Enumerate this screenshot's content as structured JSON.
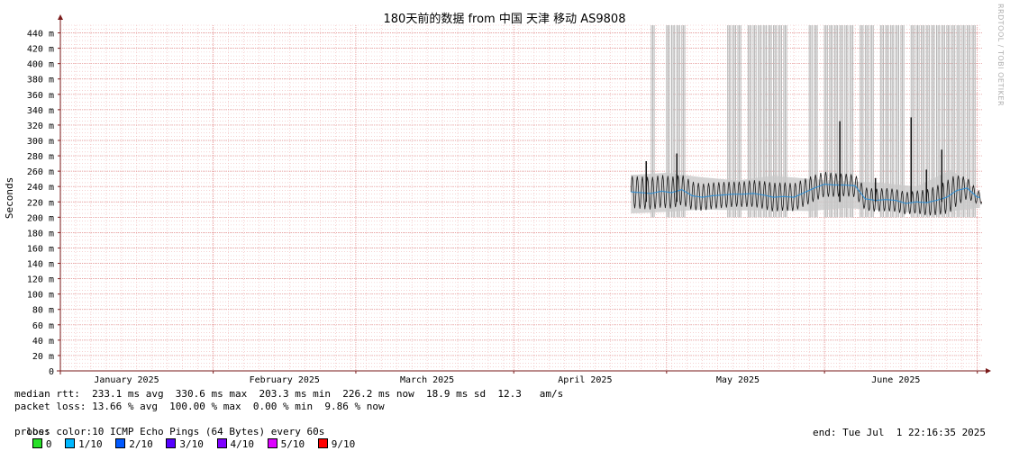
{
  "chart_data": {
    "type": "line",
    "title": "180天前的数据 from 中国 天津 移动 AS9808",
    "ylabel": "Seconds",
    "ylim": [
      0,
      0.45
    ],
    "yticks": [
      {
        "v": 0,
        "label": "0"
      },
      {
        "v": 0.02,
        "label": "20 m"
      },
      {
        "v": 0.04,
        "label": "40 m"
      },
      {
        "v": 0.06,
        "label": "60 m"
      },
      {
        "v": 0.08,
        "label": "80 m"
      },
      {
        "v": 0.1,
        "label": "100 m"
      },
      {
        "v": 0.12,
        "label": "120 m"
      },
      {
        "v": 0.14,
        "label": "140 m"
      },
      {
        "v": 0.16,
        "label": "160 m"
      },
      {
        "v": 0.18,
        "label": "180 m"
      },
      {
        "v": 0.2,
        "label": "200 m"
      },
      {
        "v": 0.22,
        "label": "220 m"
      },
      {
        "v": 0.24,
        "label": "240 m"
      },
      {
        "v": 0.26,
        "label": "260 m"
      },
      {
        "v": 0.28,
        "label": "280 m"
      },
      {
        "v": 0.3,
        "label": "300 m"
      },
      {
        "v": 0.32,
        "label": "320 m"
      },
      {
        "v": 0.34,
        "label": "340 m"
      },
      {
        "v": 0.36,
        "label": "360 m"
      },
      {
        "v": 0.38,
        "label": "380 m"
      },
      {
        "v": 0.4,
        "label": "400 m"
      },
      {
        "v": 0.42,
        "label": "420 m"
      },
      {
        "v": 0.44,
        "label": "440 m"
      }
    ],
    "xlim": [
      "2025-01-02",
      "2025-07-01"
    ],
    "xticks": [
      {
        "date": "2025-01-15",
        "label": "January 2025"
      },
      {
        "date": "2025-02-15",
        "label": "February 2025"
      },
      {
        "date": "2025-03-15",
        "label": "March 2025"
      },
      {
        "date": "2025-04-15",
        "label": "April 2025"
      },
      {
        "date": "2025-05-15",
        "label": "May 2025"
      },
      {
        "date": "2025-06-15",
        "label": "June 2025"
      }
    ],
    "month_starts": [
      "2025-01-01",
      "2025-02-01",
      "2025-03-01",
      "2025-04-01",
      "2025-05-01",
      "2025-06-01",
      "2025-07-01"
    ],
    "data_start": "2025-04-24",
    "data_end": "2025-07-01",
    "series": [
      {
        "x": [
          "2025-04-24",
          "2025-04-26",
          "2025-04-28",
          "2025-04-30",
          "2025-05-02",
          "2025-05-04",
          "2025-05-06",
          "2025-05-08",
          "2025-05-10",
          "2025-05-12",
          "2025-05-14",
          "2025-05-16",
          "2025-05-18",
          "2025-05-20",
          "2025-05-22",
          "2025-05-24",
          "2025-05-26",
          "2025-05-28",
          "2025-05-30",
          "2025-06-01",
          "2025-06-03",
          "2025-06-05",
          "2025-06-07",
          "2025-06-09",
          "2025-06-11",
          "2025-06-13",
          "2025-06-15",
          "2025-06-17",
          "2025-06-19",
          "2025-06-21",
          "2025-06-23",
          "2025-06-25",
          "2025-06-27",
          "2025-06-29",
          "2025-07-01"
        ],
        "values": [
          0.233,
          0.232,
          0.231,
          0.234,
          0.232,
          0.236,
          0.228,
          0.226,
          0.228,
          0.229,
          0.23,
          0.23,
          0.231,
          0.229,
          0.226,
          0.227,
          0.226,
          0.232,
          0.238,
          0.243,
          0.242,
          0.242,
          0.241,
          0.224,
          0.222,
          0.223,
          0.222,
          0.218,
          0.22,
          0.219,
          0.222,
          0.226,
          0.235,
          0.238,
          0.226
        ]
      }
    ],
    "range_bands": [
      {
        "x": [
          "2025-04-24",
          "2025-05-01",
          "2025-05-08",
          "2025-05-15",
          "2025-05-22",
          "2025-05-29",
          "2025-06-05",
          "2025-06-12",
          "2025-06-19",
          "2025-06-26",
          "2025-07-01"
        ],
        "min": [
          0.205,
          0.207,
          0.21,
          0.209,
          0.209,
          0.208,
          0.212,
          0.209,
          0.205,
          0.208,
          0.212
        ],
        "max": [
          0.255,
          0.258,
          0.252,
          0.248,
          0.254,
          0.25,
          0.247,
          0.245,
          0.24,
          0.262,
          0.232
        ]
      }
    ],
    "spikes": [
      {
        "date": "2025-04-27",
        "value": 0.273
      },
      {
        "date": "2025-05-03",
        "value": 0.283
      },
      {
        "date": "2025-06-04",
        "value": 0.325
      },
      {
        "date": "2025-06-11",
        "value": 0.251
      },
      {
        "date": "2025-06-18",
        "value": 0.33
      },
      {
        "date": "2025-06-21",
        "value": 0.262
      },
      {
        "date": "2025-06-24",
        "value": 0.288
      }
    ],
    "loss_periods": [
      "2025-04-28",
      "2025-05-01",
      "2025-05-02",
      "2025-05-03",
      "2025-05-04",
      "2025-05-13",
      "2025-05-14",
      "2025-05-15",
      "2025-05-17",
      "2025-05-18",
      "2025-05-19",
      "2025-05-20",
      "2025-05-21",
      "2025-05-22",
      "2025-05-23",
      "2025-05-24",
      "2025-05-29",
      "2025-05-30",
      "2025-06-01",
      "2025-06-02",
      "2025-06-03",
      "2025-06-04",
      "2025-06-05",
      "2025-06-06",
      "2025-06-08",
      "2025-06-09",
      "2025-06-10",
      "2025-06-12",
      "2025-06-13",
      "2025-06-14",
      "2025-06-15",
      "2025-06-16",
      "2025-06-18",
      "2025-06-19",
      "2025-06-20",
      "2025-06-21",
      "2025-06-22",
      "2025-06-23",
      "2025-06-24",
      "2025-06-25",
      "2025-06-26",
      "2025-06-27",
      "2025-06-28",
      "2025-06-29",
      "2025-06-30"
    ],
    "grid": true,
    "colors": {
      "grid": "#f0b7b7",
      "axis": "#7a1a1a",
      "line": "#1a1a1a",
      "smoke": "#c9c9c9",
      "loss": "#b5b5b5",
      "median": "#2a8fd8"
    }
  },
  "stats": {
    "rtt": "median rtt:  233.1 ms avg  330.6 ms max  203.3 ms min  226.2 ms now  18.9 ms sd  12.3   am/s",
    "loss": "packet loss: 13.66 % avg  100.00 % max  0.00 % min  9.86 % now",
    "loss_color_label": "loss color:",
    "loss_colors": [
      {
        "label": "0",
        "color": "#26e026"
      },
      {
        "label": "1/10",
        "color": "#00b8ff"
      },
      {
        "label": "2/10",
        "color": "#0059ff"
      },
      {
        "label": "3/10",
        "color": "#5500ff"
      },
      {
        "label": "4/10",
        "color": "#7e00ff"
      },
      {
        "label": "5/10",
        "color": "#dd00ff"
      },
      {
        "label": "9/10",
        "color": "#ff0000"
      }
    ],
    "probe": "probe:       10 ICMP Echo Pings (64 Bytes) every 60s",
    "end": "end: Tue Jul  1 22:16:35 2025"
  },
  "watermark": "RRDTOOL / TOBI OETIKER"
}
